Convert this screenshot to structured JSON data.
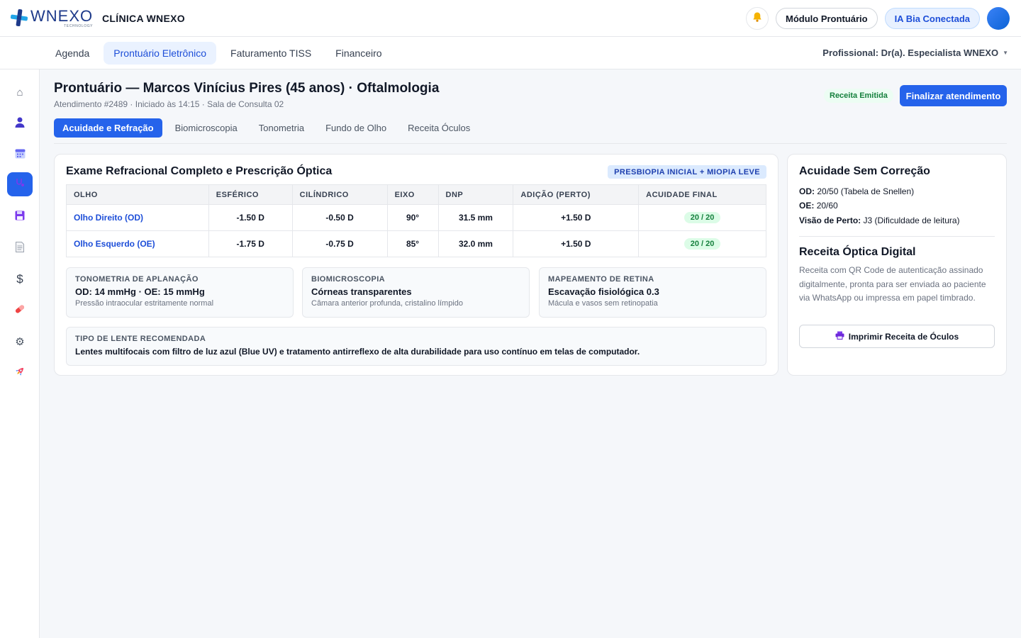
{
  "brand": {
    "logo_word": "WNEXO",
    "logo_tag": "TECHNOLOGY",
    "clinic_name": "CLÍNICA WNEXO"
  },
  "header": {
    "module_label": "Módulo Prontuário",
    "ia_label": "IA Bia Conectada"
  },
  "nav": {
    "tabs": [
      {
        "label": "Agenda"
      },
      {
        "label": "Prontuário Eletrônico"
      },
      {
        "label": "Faturamento TISS"
      },
      {
        "label": "Financeiro"
      }
    ],
    "professional": "Profissional: Dr(a). Especialista WNEXO"
  },
  "sidebar": {
    "items": [
      {
        "icon": "home-icon"
      },
      {
        "icon": "patient-icon"
      },
      {
        "icon": "calendar-icon"
      },
      {
        "icon": "medical-record-icon"
      },
      {
        "icon": "save-icon"
      },
      {
        "icon": "document-icon"
      },
      {
        "icon": "dollar-icon"
      },
      {
        "icon": "pill-icon"
      },
      {
        "icon": "gear-icon"
      },
      {
        "icon": "rocket-icon"
      }
    ]
  },
  "page": {
    "title": "Prontuário — Marcos Vinícius Pires (45 anos) · Oftalmologia",
    "subtitle": "Atendimento #2489 · Iniciado às 14:15 · Sala de Consulta 02",
    "status_badge": "Receita Emitida",
    "finalize_label": "Finalizar atendimento"
  },
  "sub_tabs": [
    {
      "label": "Acuidade e Refração"
    },
    {
      "label": "Biomicroscopia"
    },
    {
      "label": "Tonometria"
    },
    {
      "label": "Fundo de Olho"
    },
    {
      "label": "Receita Óculos"
    }
  ],
  "exam": {
    "title": "Exame Refracional Completo e Prescrição Óptica",
    "diagnosis": "PRESBIOPIA INICIAL + MIOPIA LEVE",
    "columns": [
      "OLHO",
      "ESFÉRICO",
      "CILÍNDRICO",
      "EIXO",
      "DNP",
      "ADIÇÃO (PERTO)",
      "ACUIDADE FINAL"
    ],
    "rows": [
      {
        "eye": "Olho Direito (OD)",
        "spherical": "-1.50 D",
        "cylindrical": "-0.50 D",
        "axis": "90°",
        "dnp": "31.5 mm",
        "add": "+1.50 D",
        "acuity": "20 / 20"
      },
      {
        "eye": "Olho Esquerdo (OE)",
        "spherical": "-1.75 D",
        "cylindrical": "-0.75 D",
        "axis": "85°",
        "dnp": "32.0 mm",
        "add": "+1.50 D",
        "acuity": "20 / 20"
      }
    ],
    "mini_cards": [
      {
        "label": "TONOMETRIA DE APLANAÇÃO",
        "value": "OD: 14 mmHg · OE: 15 mmHg",
        "note": "Pressão intraocular estritamente normal"
      },
      {
        "label": "BIOMICROSCOPIA",
        "value": "Córneas transparentes",
        "note": "Câmara anterior profunda, cristalino límpido"
      },
      {
        "label": "MAPEAMENTO DE RETINA",
        "value": "Escavação fisiológica 0.3",
        "note": "Mácula e vasos sem retinopatia"
      }
    ],
    "lens": {
      "label": "TIPO DE LENTE RECOMENDADA",
      "text": "Lentes multifocais com filtro de luz azul (Blue UV) e tratamento antirreflexo de alta durabilidade para uso contínuo em telas de computador."
    }
  },
  "side_panel": {
    "acuity_title": "Acuidade Sem Correção",
    "od_label": "OD:",
    "od_value": "20/50 (Tabela de Snellen)",
    "oe_label": "OE:",
    "oe_value": "20/60",
    "near_label": "Visão de Perto:",
    "near_value": "J3 (Dificuldade de leitura)",
    "rx_title": "Receita Óptica Digital",
    "rx_desc": "Receita com QR Code de autenticação assinado digitalmente, pronta para ser enviada ao paciente via WhatsApp ou impressa em papel timbrado.",
    "print_label": "Imprimir Receita de Óculos"
  },
  "colors": {
    "primary": "#2563eb",
    "success": "#15803d",
    "brand": "#1e3a8a"
  }
}
